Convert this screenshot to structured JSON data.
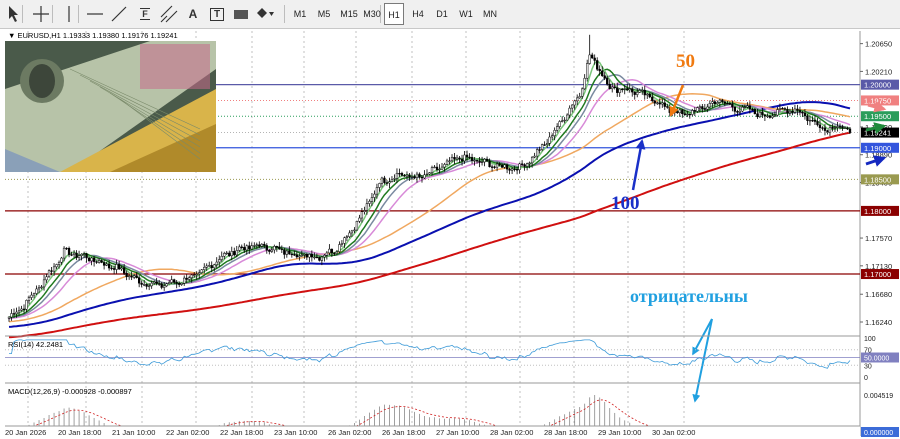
{
  "toolbar": {
    "tools": [
      {
        "name": "cursor-arrow-icon"
      },
      {
        "name": "crosshair-icon"
      },
      {
        "name": "vertical-line-icon"
      },
      {
        "name": "horizontal-line-icon"
      },
      {
        "name": "trendline-icon"
      },
      {
        "name": "fibonacci-icon",
        "label": "F"
      },
      {
        "name": "channel-icon"
      },
      {
        "name": "text-tool-icon",
        "label": "A"
      },
      {
        "name": "text-label-icon",
        "label": "T"
      },
      {
        "name": "rectangle-icon"
      },
      {
        "name": "shapes-dropdown-icon"
      }
    ],
    "timeframes": [
      "M1",
      "M5",
      "M15",
      "M30",
      "H1",
      "H4",
      "D1",
      "W1",
      "MN"
    ],
    "active_timeframe": "H1"
  },
  "chart_data": {
    "type": "candlestick",
    "symbol_header": "EURUSD,H1  1.19333 1.19380 1.19176 1.19241",
    "x_tick_labels": [
      "20 Jan 2026",
      "20 Jan 18:00",
      "21 Jan 10:00",
      "22 Jan 02:00",
      "22 Jan 18:00",
      "23 Jan 10:00",
      "26 Jan 02:00",
      "26 Jan 18:00",
      "27 Jan 10:00",
      "28 Jan 02:00",
      "28 Jan 18:00",
      "29 Jan 10:00",
      "30 Jan 02:00"
    ],
    "y_ticks": [
      1.2065,
      1.2021,
      1.1933,
      1.1889,
      1.1845,
      1.1757,
      1.1713,
      1.1668,
      1.1624
    ],
    "ylim": [
      1.1605,
      1.2085
    ],
    "last_price": 1.19241,
    "levels": [
      {
        "value": 1.2,
        "label": "1.20000",
        "color": "#5a5aa8",
        "style": "solid"
      },
      {
        "value": 1.1975,
        "label": "1.19750",
        "color": "#f08080",
        "style": "dotted"
      },
      {
        "value": 1.195,
        "label": "1.19500",
        "color": "#2a9d5b",
        "style": "dotted"
      },
      {
        "value": 1.19,
        "label": "1.19000",
        "color": "#3355dd",
        "style": "solid"
      },
      {
        "value": 1.185,
        "label": "1.18500",
        "color": "#9a9a50",
        "style": "dotted"
      },
      {
        "value": 1.18,
        "label": "1.18000",
        "color": "#8b0000",
        "style": "solid"
      },
      {
        "value": 1.17,
        "label": "1.17000",
        "color": "#8b0000",
        "style": "solid"
      }
    ],
    "close_anchors": [
      [
        0,
        1.1632
      ],
      [
        6,
        1.165
      ],
      [
        12,
        1.168
      ],
      [
        18,
        1.1712
      ],
      [
        22,
        1.1735
      ],
      [
        30,
        1.1728
      ],
      [
        38,
        1.1716
      ],
      [
        44,
        1.1708
      ],
      [
        52,
        1.1688
      ],
      [
        60,
        1.1682
      ],
      [
        68,
        1.1688
      ],
      [
        76,
        1.17
      ],
      [
        84,
        1.1725
      ],
      [
        92,
        1.174
      ],
      [
        100,
        1.1745
      ],
      [
        108,
        1.1738
      ],
      [
        116,
        1.173
      ],
      [
        124,
        1.1728
      ],
      [
        130,
        1.1738
      ],
      [
        136,
        1.1765
      ],
      [
        142,
        1.18
      ],
      [
        148,
        1.1845
      ],
      [
        156,
        1.1858
      ],
      [
        164,
        1.1852
      ],
      [
        172,
        1.1868
      ],
      [
        180,
        1.1885
      ],
      [
        188,
        1.1878
      ],
      [
        196,
        1.187
      ],
      [
        204,
        1.1868
      ],
      [
        210,
        1.1888
      ],
      [
        216,
        1.1915
      ],
      [
        222,
        1.195
      ],
      [
        228,
        1.1985
      ],
      [
        232,
        1.2045
      ],
      [
        236,
        1.2025
      ],
      [
        240,
        1.1995
      ],
      [
        248,
        1.1992
      ],
      [
        256,
        1.198
      ],
      [
        264,
        1.196
      ],
      [
        270,
        1.1952
      ],
      [
        278,
        1.1965
      ],
      [
        284,
        1.1975
      ],
      [
        290,
        1.1962
      ],
      [
        296,
        1.196
      ],
      [
        302,
        1.195
      ],
      [
        308,
        1.1958
      ],
      [
        314,
        1.1962
      ],
      [
        320,
        1.1945
      ],
      [
        326,
        1.193
      ],
      [
        332,
        1.1935
      ],
      [
        336,
        1.1924
      ]
    ],
    "series": [
      {
        "name": "ma-fast",
        "color": "#7ac67a",
        "period": 5
      },
      {
        "name": "ma-green",
        "color": "#1f7a1f",
        "period": 10
      },
      {
        "name": "ma-slate",
        "color": "#7a8aa0",
        "period": 14
      },
      {
        "name": "ma-pink",
        "color": "#d88ad8",
        "period": 21
      },
      {
        "name": "ma-orange",
        "color": "#f0a860",
        "period": 50
      },
      {
        "name": "ma-blue",
        "color": "#0a10b0",
        "period": 100
      },
      {
        "name": "ma-red",
        "color": "#d01010",
        "period": 200
      }
    ],
    "annotations": [
      {
        "text": "50",
        "color": "#f07a10"
      },
      {
        "text": "100",
        "color": "#1a30c8"
      },
      {
        "text": "отрицательны",
        "color": "#20a0e0"
      }
    ],
    "rsi": {
      "label": "RSI(14) 42.2481",
      "ticks": [
        "100",
        "70",
        "50.0000",
        "30",
        "0"
      ],
      "current": 42.2
    }
  },
  "macd": {
    "label": "MACD(12,26,9) -0.000928 -0.000897",
    "ticks": [
      "0.004519",
      "0.000000"
    ]
  }
}
